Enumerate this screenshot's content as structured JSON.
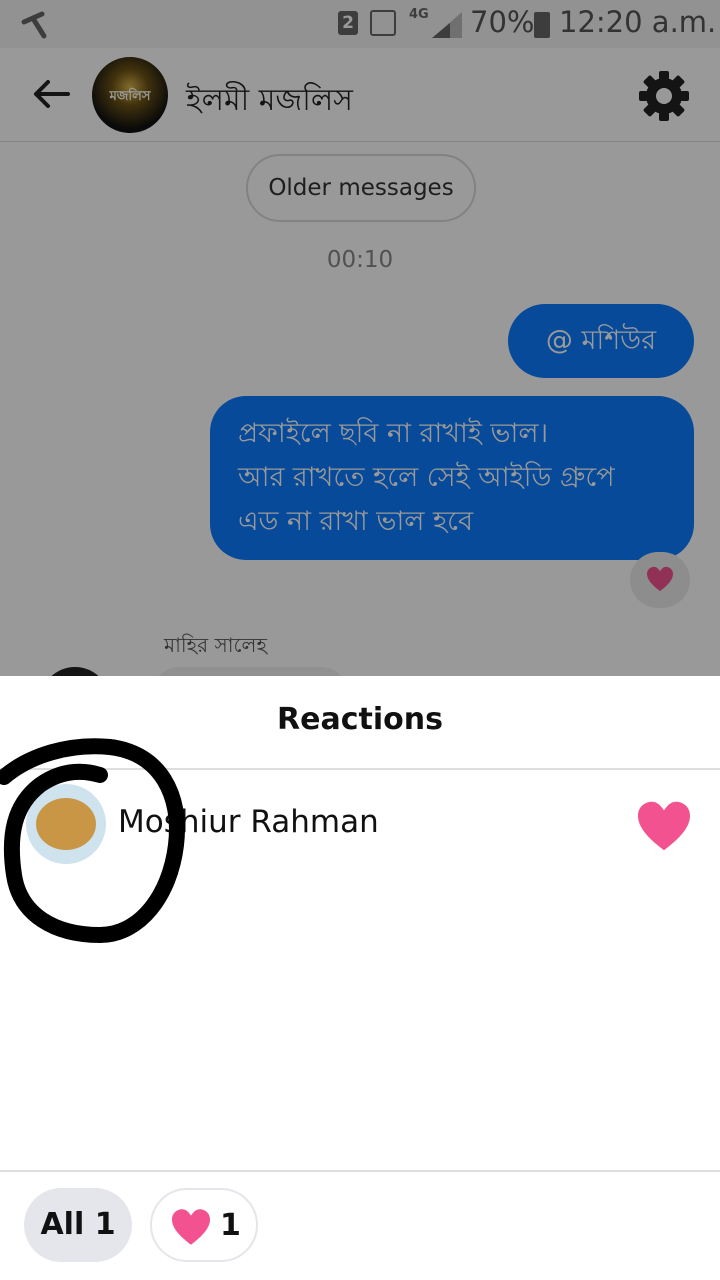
{
  "status_bar": {
    "sim_slot": "2",
    "network": "4G",
    "battery": "70%",
    "time": "12:20 a.m."
  },
  "header": {
    "group_name": "ইলমী মজলিস",
    "avatar_text": "মজলিস"
  },
  "chat": {
    "older_messages_label": "Older messages",
    "timestamp": "00:10",
    "messages": [
      {
        "text": "@ মশিউর"
      },
      {
        "lines": [
          "প্রফাইলে ছবি না রাখাই ভাল।",
          "আর রাখতে হলে সেই আইডি গ্রুপে",
          "এড না রাখা ভাল হবে"
        ]
      }
    ],
    "next_sender": "মাহির সালেহ"
  },
  "reactions": {
    "title": "Reactions",
    "reactors": [
      {
        "name": "Moshiur Rahman",
        "reaction_icon": "heart-icon"
      }
    ],
    "tabs": [
      {
        "label": "All",
        "count": "1"
      },
      {
        "icon": "heart-icon",
        "count": "1"
      }
    ]
  },
  "colors": {
    "bubble": "#0a7cff",
    "heart": "#f25390",
    "scribble": "#000000"
  }
}
